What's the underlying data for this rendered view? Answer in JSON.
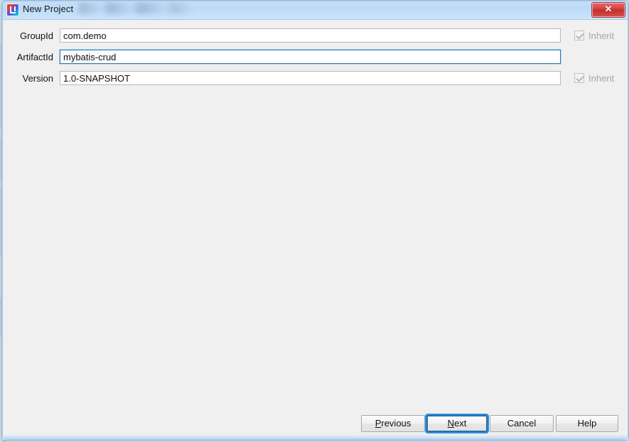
{
  "window": {
    "title": "New Project",
    "icon": "intellij-idea-icon",
    "obscured_title_suffix": "",
    "close_label": "✕",
    "accent_focus_color": "#2f8fdf",
    "titlebar_color": "#bcd9f7",
    "body_color": "#f0f0f0"
  },
  "form": {
    "rows": [
      {
        "label": "GroupId",
        "value": "com.demo",
        "placeholder": "",
        "focused": false,
        "inherit": {
          "label": "Inherit",
          "checked": true,
          "enabled": false,
          "visible": true
        }
      },
      {
        "label": "ArtifactId",
        "value": "mybatis-crud",
        "placeholder": "",
        "focused": true,
        "inherit": {
          "label": "",
          "checked": false,
          "enabled": false,
          "visible": false
        }
      },
      {
        "label": "Version",
        "value": "1.0-SNAPSHOT",
        "placeholder": "",
        "focused": false,
        "inherit": {
          "label": "Inherit",
          "checked": true,
          "enabled": false,
          "visible": true
        }
      }
    ]
  },
  "buttons": {
    "previous": {
      "mnemonic": "P",
      "rest": "revious"
    },
    "next": {
      "mnemonic": "N",
      "rest": "ext",
      "focused": true
    },
    "cancel": {
      "label": "Cancel"
    },
    "help": {
      "label": "Help"
    }
  }
}
